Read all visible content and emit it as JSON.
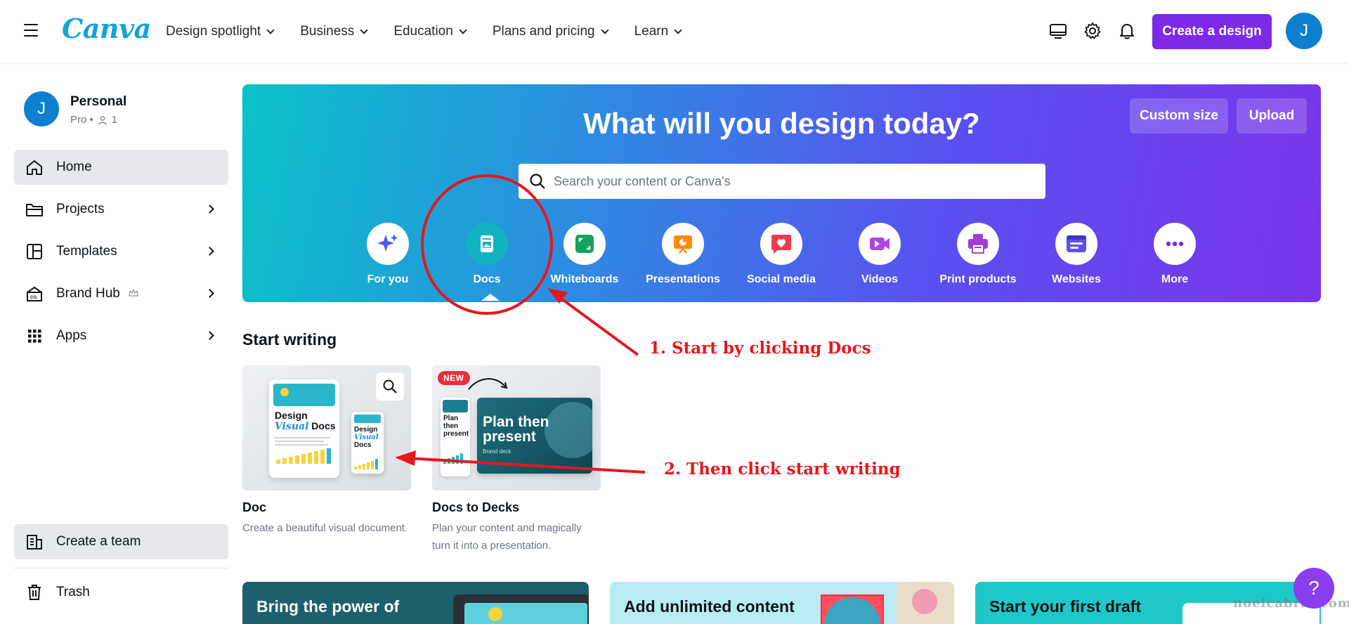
{
  "nav": {
    "logo": "Canva",
    "links": [
      "Design spotlight",
      "Business",
      "Education",
      "Plans and pricing",
      "Learn"
    ],
    "create_button": "Create a design",
    "avatar_initial": "J"
  },
  "sidebar": {
    "profile_name": "Personal",
    "profile_plan": "Pro •",
    "profile_members": "1",
    "avatar_initial": "J",
    "items": [
      {
        "label": "Home"
      },
      {
        "label": "Projects"
      },
      {
        "label": "Templates"
      },
      {
        "label": "Brand Hub"
      },
      {
        "label": "Apps"
      }
    ],
    "create_team": "Create a team",
    "trash": "Trash"
  },
  "hero": {
    "title": "What will you design today?",
    "custom_size": "Custom size",
    "upload": "Upload",
    "search_placeholder": "Search your content or Canva's",
    "categories": [
      {
        "label": "For you",
        "icon": "sparkle-icon",
        "color": "#4a5cf0"
      },
      {
        "label": "Docs",
        "icon": "doc-icon",
        "color": "#12b3c0"
      },
      {
        "label": "Whiteboards",
        "icon": "whiteboard-icon",
        "color": "#12a35c"
      },
      {
        "label": "Presentations",
        "icon": "presentation-icon",
        "color": "#ff8a00"
      },
      {
        "label": "Social media",
        "icon": "heart-icon",
        "color": "#ef3b4f"
      },
      {
        "label": "Videos",
        "icon": "video-icon",
        "color": "#b144e0"
      },
      {
        "label": "Print products",
        "icon": "printer-icon",
        "color": "#a23ed6"
      },
      {
        "label": "Websites",
        "icon": "website-icon",
        "color": "#5a52e6"
      },
      {
        "label": "More",
        "icon": "more-icon",
        "color": "#7d2ae8"
      }
    ]
  },
  "start_writing": {
    "title": "Start writing",
    "cards": [
      {
        "title": "Doc",
        "desc": "Create a beautiful visual document.",
        "thumb_big_line1": "Design",
        "thumb_big_line2": "Visual",
        "thumb_big_line3": "Docs",
        "thumb_small_line1": "Design",
        "thumb_small_line2": "Visual",
        "thumb_small_line3": "Docs"
      },
      {
        "title": "Docs to Decks",
        "desc": "Plan your content and magically turn it into a presentation.",
        "badge": "NEW",
        "thumb_small_text": "Plan then present",
        "thumb_big_text": "Plan then present",
        "thumb_sub": "Brand deck"
      }
    ]
  },
  "promos": [
    {
      "text": "Bring the power of"
    },
    {
      "text": "Add unlimited content"
    },
    {
      "text": "Start your first draft"
    }
  ],
  "help_label": "?",
  "watermark": "noelcabral.com",
  "annotations": {
    "step1": "1. Start by clicking Docs",
    "step2": "2. Then click start writing"
  },
  "colors": {
    "brand_purple": "#7d2ae8",
    "logo_blue": "#14a3d8",
    "annotation_red": "#e8161d"
  }
}
